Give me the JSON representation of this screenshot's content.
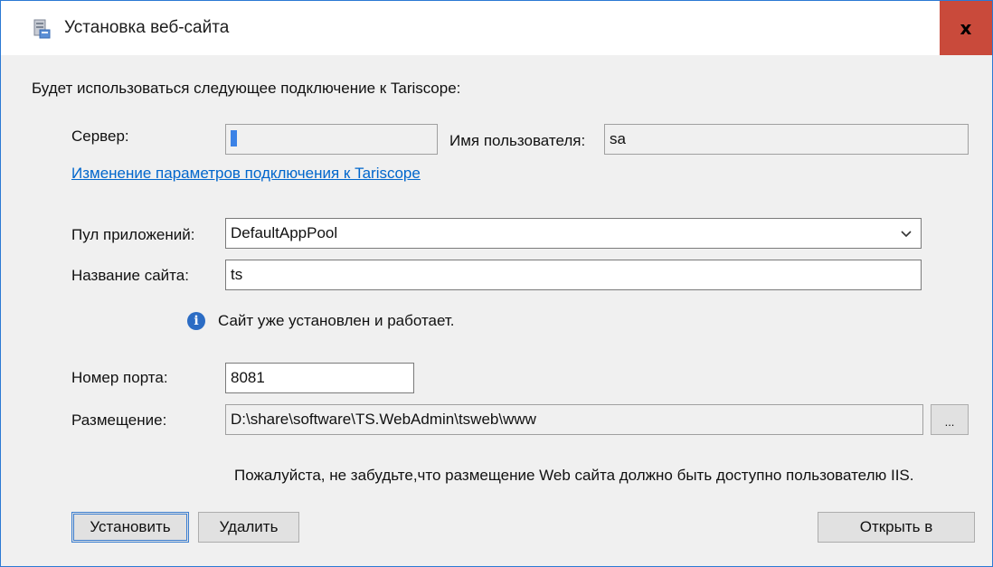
{
  "window": {
    "title": "Установка веб-сайта",
    "close_label": "x"
  },
  "connection": {
    "intro": "Будет использоваться следующее подключение к Tariscope:",
    "server_label": "Сервер:",
    "server_value": ".",
    "user_label": "Имя пользователя:",
    "user_value": "sa",
    "change_link": "Изменение параметров подключения к Tariscope"
  },
  "site": {
    "app_pool_label": "Пул приложений:",
    "app_pool_value": "DefaultAppPool",
    "site_name_label": "Название сайта:",
    "site_name_value": "ts",
    "status_message": "Сайт уже установлен и работает.",
    "port_label": "Номер порта:",
    "port_value": "8081",
    "location_label": "Размещение:",
    "location_value": "D:\\share\\software\\TS.WebAdmin\\tsweb\\www",
    "browse_label": "...",
    "note": "Пожалуйста, не забудьте,что размещение Web сайта должно быть доступно пользователю IIS."
  },
  "buttons": {
    "install": "Установить",
    "remove": "Удалить",
    "open_in": "Открыть в"
  },
  "colors": {
    "close_button": "#c94a3b",
    "link": "#0066cc",
    "info_icon": "#2b6cc4",
    "window_border": "#2b79d4"
  }
}
